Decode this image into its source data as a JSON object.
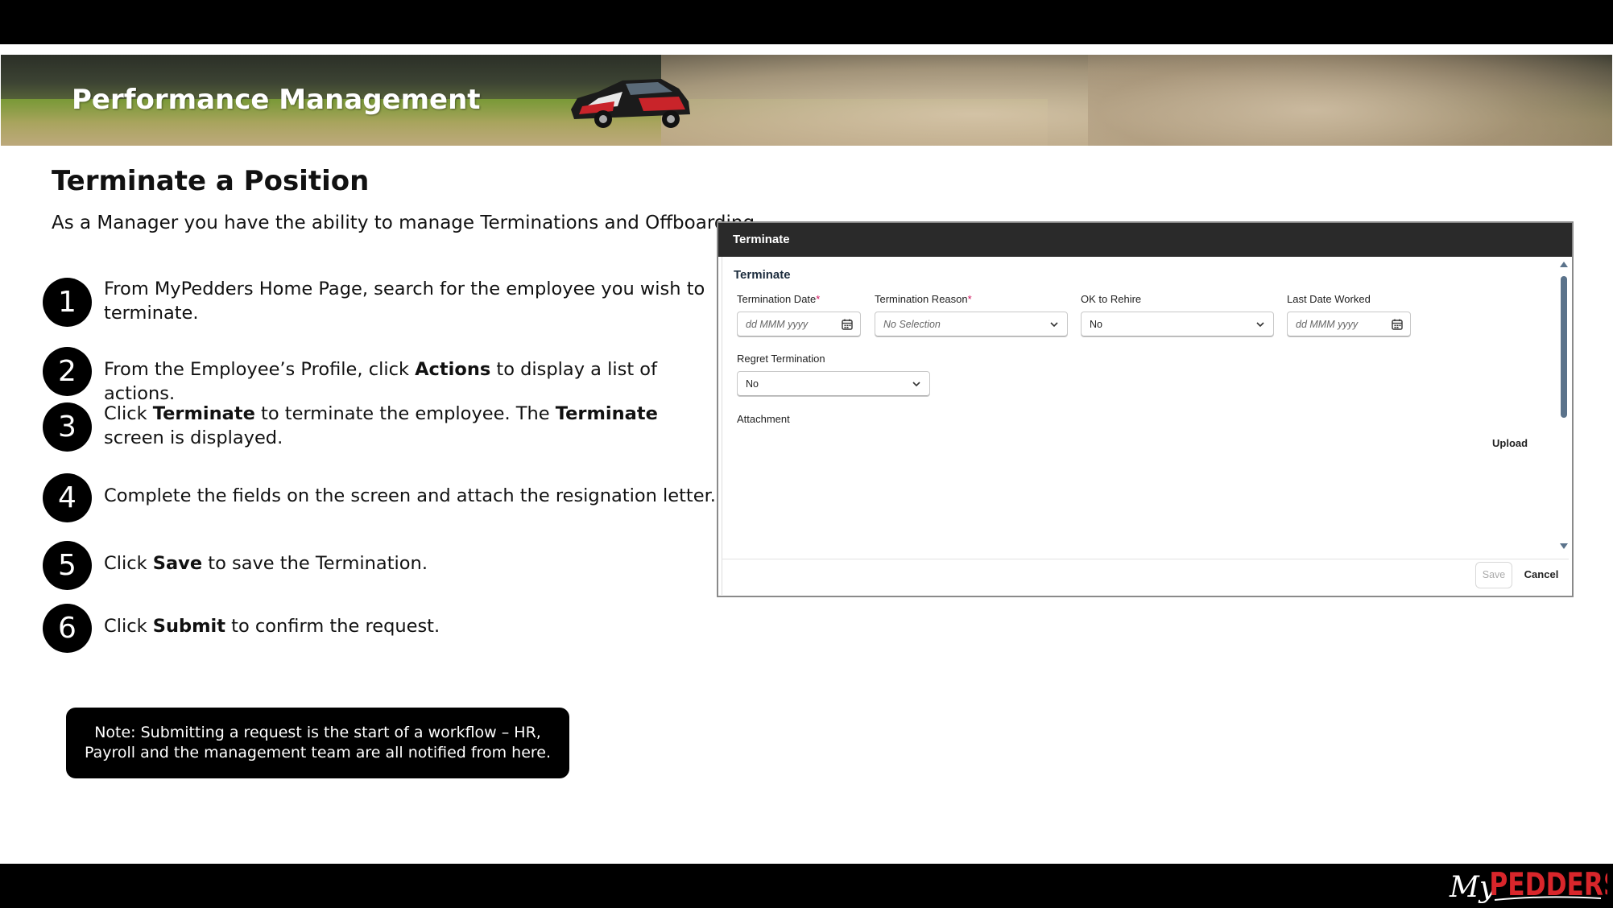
{
  "banner": {
    "title": "Performance Management"
  },
  "page": {
    "title": "Terminate a Position",
    "intro": "As a Manager you have the ability to manage Terminations and Offboarding"
  },
  "steps": [
    {
      "num": "1",
      "parts": [
        {
          "t": "From MyPedders Home Page, search for the employee you wish to terminate."
        }
      ]
    },
    {
      "num": "2",
      "parts": [
        {
          "t": "From the Employee’s Profile, click "
        },
        {
          "t": "Actions",
          "b": true
        },
        {
          "t": " to display a list of actions."
        }
      ]
    },
    {
      "num": "3",
      "parts": [
        {
          "t": "Click "
        },
        {
          "t": "Terminate",
          "b": true
        },
        {
          "t": " to terminate the employee. The "
        },
        {
          "t": "Terminate",
          "b": true
        },
        {
          "t": " screen is displayed."
        }
      ]
    },
    {
      "num": "4",
      "parts": [
        {
          "t": "Complete the fields on the screen and attach the resignation letter."
        }
      ]
    },
    {
      "num": "5",
      "parts": [
        {
          "t": "Click "
        },
        {
          "t": "Save",
          "b": true
        },
        {
          "t": " to save the Termination."
        }
      ]
    },
    {
      "num": "6",
      "parts": [
        {
          "t": "Click "
        },
        {
          "t": "Submit",
          "b": true
        },
        {
          "t": " to confirm the request."
        }
      ]
    }
  ],
  "note": "Note: Submitting a request is the start of a workflow – HR, Payroll and the management team are all notified from here.",
  "dialog": {
    "header": "Terminate",
    "section": "Terminate",
    "termination_date": {
      "label": "Termination Date",
      "required": "*",
      "placeholder": "dd MMM yyyy",
      "icon": "calendar-icon"
    },
    "termination_reason": {
      "label": "Termination Reason",
      "required": "*",
      "value": "No Selection",
      "icon": "chevron-down-icon"
    },
    "ok_to_rehire": {
      "label": "OK to Rehire",
      "value": "No",
      "icon": "chevron-down-icon"
    },
    "last_date_worked": {
      "label": "Last Date Worked",
      "placeholder": "dd MMM yyyy",
      "icon": "calendar-icon"
    },
    "regret_termination": {
      "label": "Regret Termination",
      "value": "No",
      "icon": "chevron-down-icon"
    },
    "attachment": {
      "label": "Attachment",
      "upload": "Upload"
    },
    "footer": {
      "save": "Save",
      "cancel": "Cancel"
    }
  },
  "logo": {
    "text_my": "My",
    "text_brand": "PEDDERS",
    "brand_color": "#d9262b"
  }
}
